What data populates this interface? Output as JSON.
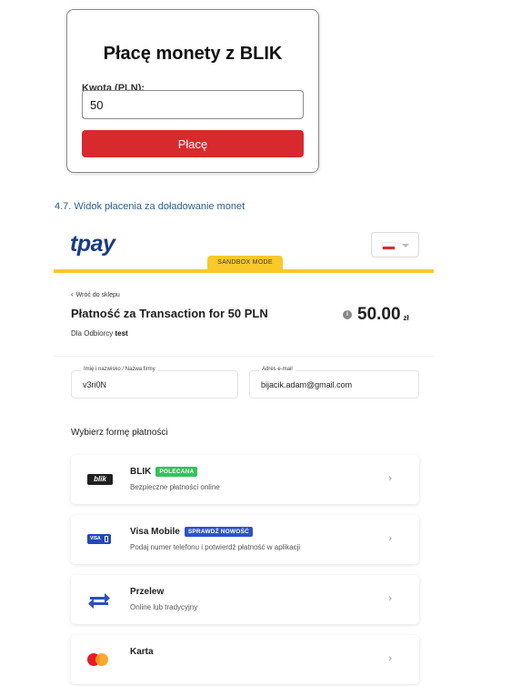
{
  "blik_form": {
    "title": "Płacę monety z BLIK",
    "amount_label": "Kwota (PLN):",
    "amount_value": "50",
    "pay_button": "Płacę"
  },
  "caption": "4.7. Widok płacenia za doładowanie monet",
  "tpay": {
    "logo": "tpay",
    "sandbox_label": "SANDBOX MODE",
    "language_flag": "flag-pl-icon",
    "back_link": "Wróć do sklepu",
    "payment_title": "Płatność za Transaction for 50 PLN",
    "amount": "50.00",
    "currency": "zł",
    "recipient_prefix": "Dla Odbiorcy",
    "recipient_name": "test",
    "name_field": {
      "label": "Imię i nazwisko / Nazwa firmy",
      "value": "v3ri0N"
    },
    "email_field": {
      "label": "Adres e-mail",
      "value": "bijacik.adam@gmail.com"
    },
    "methods_title": "Wybierz formę płatności",
    "methods": [
      {
        "name": "BLIK",
        "badge": "POLECANA",
        "desc": "Bezpieczne płatności online",
        "icon": "blik"
      },
      {
        "name": "Visa Mobile",
        "badge": "SPRAWDŹ NOWOŚĆ",
        "desc": "Podaj numer telefonu i potwierdź płatność w aplikacji",
        "icon": "VISA"
      },
      {
        "name": "Przelew",
        "badge": "",
        "desc": "Online lub tradycyjny",
        "icon": "transfer-arrows-icon"
      },
      {
        "name": "Karta",
        "badge": "",
        "desc": "",
        "icon": "mastercard-icon"
      }
    ]
  },
  "colors": {
    "blik_button": "#d8292f",
    "tpay_blue": "#1b3c82",
    "sandbox_yellow": "#f9c82b",
    "badge_green": "#37c15a",
    "badge_blue": "#2f52c8"
  }
}
